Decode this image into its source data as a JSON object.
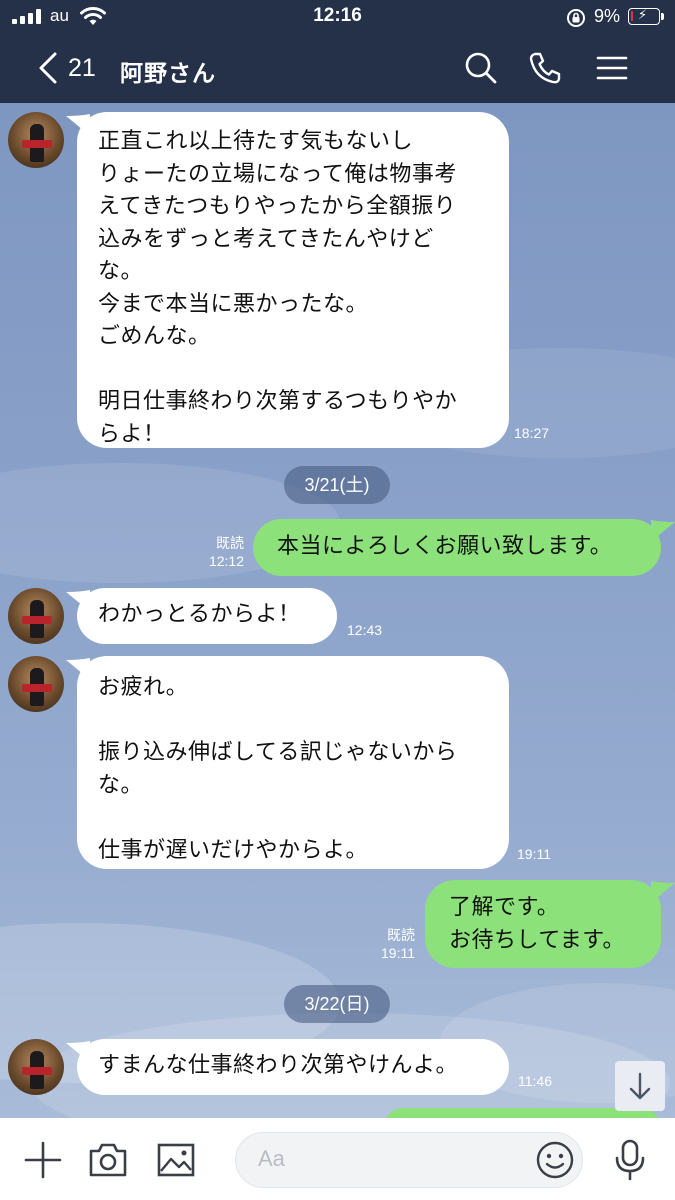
{
  "status": {
    "carrier": "au",
    "time": "12:16",
    "battery_percent_text": "9%",
    "battery_level": 0.09,
    "battery_color": "#e5323b"
  },
  "header": {
    "back_count": "21",
    "title": "阿野さん",
    "icons": [
      "search-icon",
      "phone-icon",
      "menu-icon"
    ]
  },
  "colors": {
    "header_bg": "#253149",
    "incoming_bubble": "#ffffff",
    "outgoing_bubble": "#8ce17a",
    "chat_bg": "#8aa1c9"
  },
  "messages": [
    {
      "dir": "in",
      "text": "正直これ以上待たす気もないし\nりょーたの立場になって俺は物事考\nえてきたつもりやったから全額振り\n込みをずっと考えてきたんやけど\nな。\n今まで本当に悪かったな。\nごめんな。\n\n明日仕事終わり次第するつもりやか\nらよ！",
      "time": "18:27"
    },
    {
      "date": "3/21(土)"
    },
    {
      "dir": "out",
      "text": "本当によろしくお願い致します。",
      "read": "既読",
      "time": "12:12"
    },
    {
      "dir": "in",
      "text": "わかっとるからよ！",
      "time": "12:43"
    },
    {
      "dir": "in",
      "text": "お疲れ。\n\n振り込み伸ばしてる訳じゃないから\nな。\n\n仕事が遅いだけやからよ。",
      "time": "19:11"
    },
    {
      "dir": "out",
      "text": "了解です。\nお待ちしてます。",
      "read": "既読",
      "time": "19:11"
    },
    {
      "date": "3/22(日)"
    },
    {
      "dir": "in",
      "text": "すまんな仕事終わり次第やけんよ。",
      "time": "11:46"
    }
  ],
  "input": {
    "placeholder": "Aa",
    "icons": [
      "plus-icon",
      "camera-icon",
      "image-icon",
      "emoji-icon",
      "mic-icon"
    ]
  }
}
